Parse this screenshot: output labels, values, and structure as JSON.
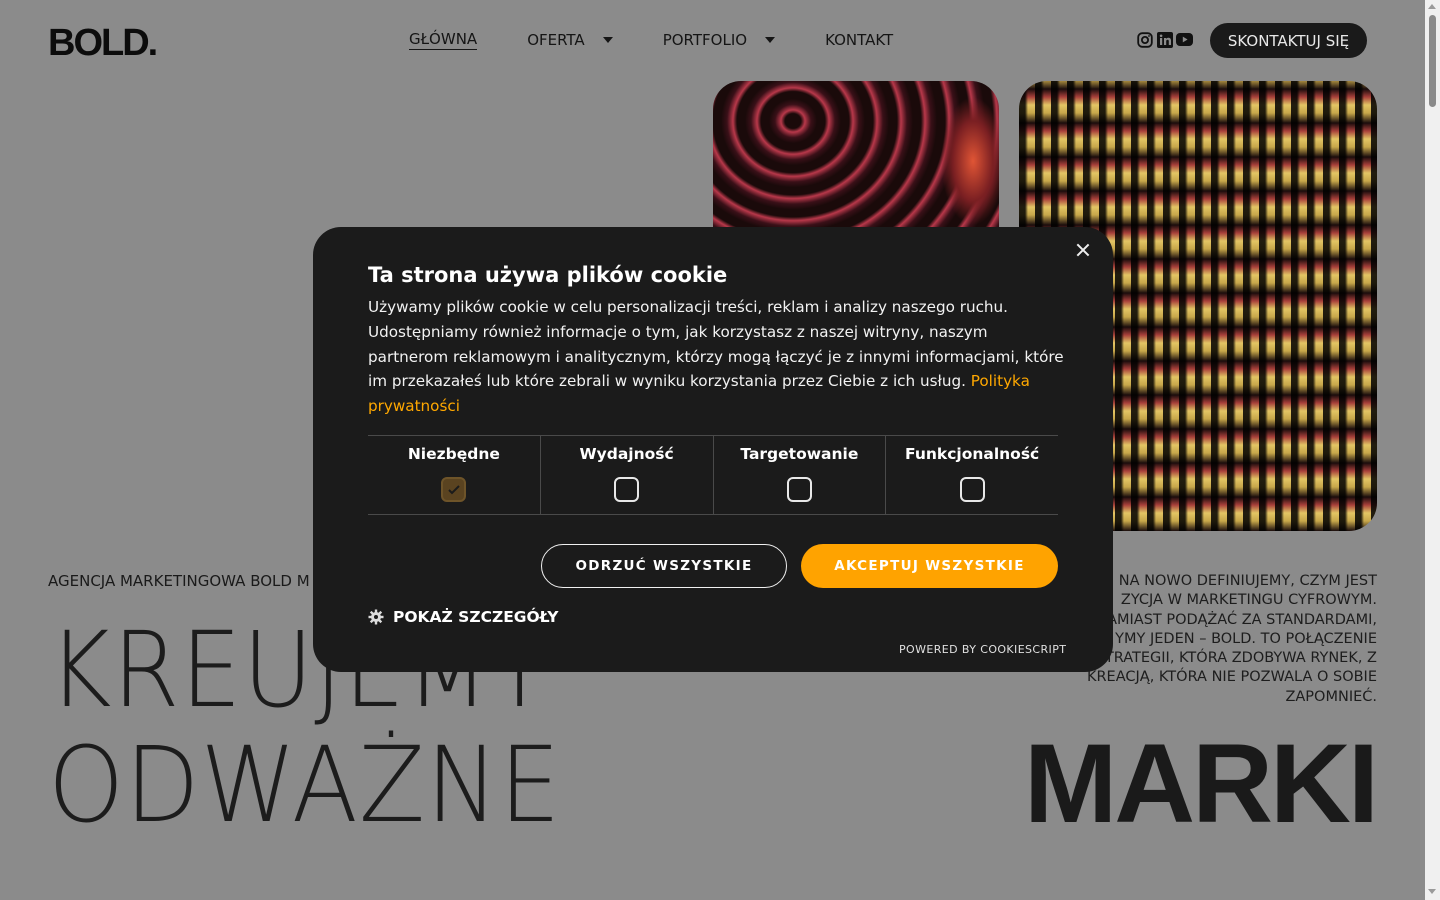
{
  "header": {
    "logo": "BOLD.",
    "nav": [
      {
        "label": "GŁÓWNA",
        "active": true,
        "dropdown": false
      },
      {
        "label": "OFERTA",
        "active": false,
        "dropdown": true
      },
      {
        "label": "PORTFOLIO",
        "active": false,
        "dropdown": true
      },
      {
        "label": "KONTAKT",
        "active": false,
        "dropdown": false
      }
    ],
    "socials": [
      "instagram-icon",
      "linkedin-icon",
      "youtube-icon"
    ],
    "contact_button": "SKONTAKTUJ SIĘ"
  },
  "hero": {
    "tagline": "AGENCJA MARKETINGOWA BOLD M",
    "headline_line1": "KREUJEMY",
    "headline_line2": "ODWAŻNE",
    "headline_bold": "MARKI",
    "right_text": "NA NOWO DEFINIUJEMY, CZYM JEST\nZYCJA W MARKETINGU CYFROWYM.\nAMIAST PODĄŻAĆ ZA STANDARDAMI,\nYMY JEDEN – BOLD. TO POŁĄCZENIE\nTRATEGII, KTÓRA ZDOBYWA RYNEK, Z\nKREACJĄ, KTÓRA NIE POZWALA O SOBIE\nZAPOMNIEĆ."
  },
  "cookie": {
    "title": "Ta strona używa plików cookie",
    "body": "Używamy plików cookie w celu personalizacji treści, reklam i analizy naszego ruchu. Udostępniamy również informacje o tym, jak korzystasz z naszej witryny, naszym partnerom reklamowym i analitycznym, którzy mogą łączyć je z innymi informacjami, które im przekazałeś lub które zebrali w wyniku korzystania przez Ciebie z ich usług. ",
    "policy_link": "Polityka prywatności",
    "categories": [
      {
        "label": "Niezbędne",
        "checked": true
      },
      {
        "label": "Wydajność",
        "checked": false
      },
      {
        "label": "Targetowanie",
        "checked": false
      },
      {
        "label": "Funkcjonalność",
        "checked": false
      }
    ],
    "reject_label": "ODRZUĆ WSZYSTKIE",
    "accept_label": "AKCEPTUJ WSZYSTKIE",
    "details_label": "POKAŻ SZCZEGÓŁY",
    "powered_by": "POWERED BY COOKIESCRIPT"
  },
  "colors": {
    "overlay_bg": "#8b8b8b",
    "dialog_bg": "#1b1b1b",
    "accent": "#ffa300"
  }
}
